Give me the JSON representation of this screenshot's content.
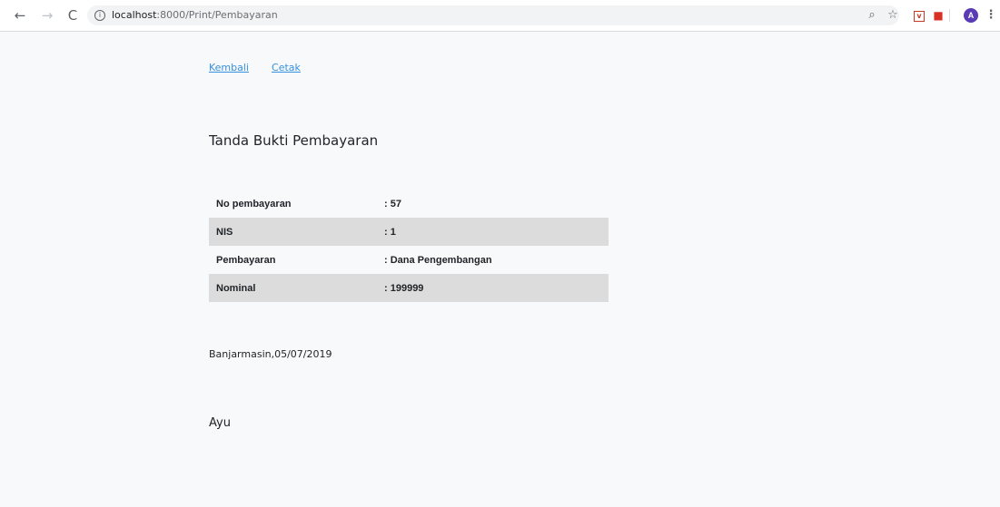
{
  "browser": {
    "url_host": "localhost",
    "url_rest": ":8000/Print/Pembayaran",
    "avatar_letter": "A"
  },
  "nav": {
    "back_label": "Kembali",
    "print_label": "Cetak"
  },
  "title": "Tanda Bukti Pembayaran",
  "receipt": {
    "rows": [
      {
        "label": "No pembayaran",
        "value": ": 57"
      },
      {
        "label": "NIS",
        "value": ": 1"
      },
      {
        "label": "Pembayaran",
        "value": ": Dana Pengembangan"
      },
      {
        "label": "Nominal",
        "value": ": 199999"
      }
    ]
  },
  "place_date": "Banjarmasin,05/07/2019",
  "signer": "Ayu",
  "colors": {
    "link": "#3490dc",
    "row_alt": "#dcdcdc",
    "page_bg": "#f8f9fb",
    "avatar": "#5b3bb5"
  },
  "icons": {
    "back": "arrow-left-icon",
    "forward": "arrow-right-icon",
    "reload": "reload-icon",
    "info": "info-icon",
    "zoom": "zoom-icon",
    "bookmark": "star-icon",
    "extension1": "pocket-extension-icon",
    "extension2": "extension-icon",
    "menu": "kebab-menu-icon"
  }
}
